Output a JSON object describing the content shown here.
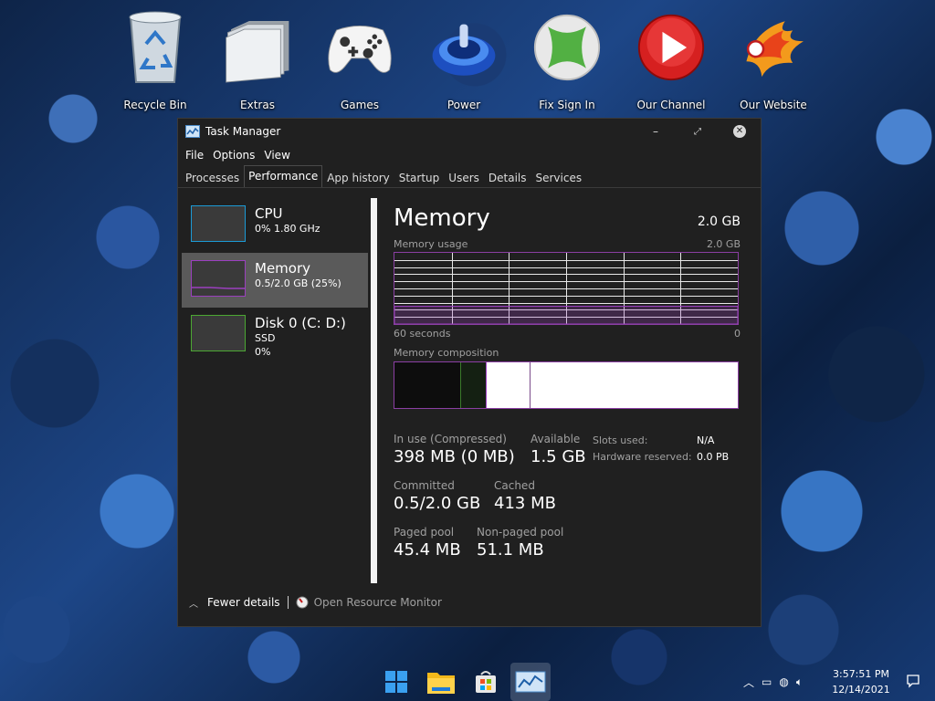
{
  "desktop": {
    "icons": [
      {
        "label": "Recycle Bin",
        "icon": "recycle-bin-icon"
      },
      {
        "label": "Extras",
        "icon": "folder-icon"
      },
      {
        "label": "Games",
        "icon": "gamepad-icon"
      },
      {
        "label": "Power",
        "icon": "power-icon"
      },
      {
        "label": "Fix Sign In",
        "icon": "xbox-icon"
      },
      {
        "label": "Our Channel",
        "icon": "play-icon"
      },
      {
        "label": "Our Website",
        "icon": "phoenix-logo-icon"
      }
    ]
  },
  "window": {
    "title": "Task Manager",
    "menu": [
      "File",
      "Options",
      "View"
    ],
    "tabs": [
      "Processes",
      "Performance",
      "App history",
      "Startup",
      "Users",
      "Details",
      "Services"
    ],
    "active_tab": "Performance"
  },
  "sidebar": {
    "items": [
      {
        "name": "CPU",
        "detail": "0%  1.80 GHz",
        "detail2": "",
        "color": "#1c9bd6"
      },
      {
        "name": "Memory",
        "detail": "0.5/2.0 GB (25%)",
        "detail2": "",
        "color": "#9b3fbf"
      },
      {
        "name": "Disk 0 (C: D:)",
        "detail": "SSD",
        "detail2": "0%",
        "color": "#4ca833"
      }
    ]
  },
  "memory": {
    "title": "Memory",
    "total": "2.0 GB",
    "usage_label": "Memory usage",
    "usage_max": "2.0 GB",
    "graph_left": "60 seconds",
    "graph_right": "0",
    "usage_fraction": 0.25,
    "composition_label": "Memory composition",
    "stats": {
      "in_use_label": "In use (Compressed)",
      "in_use_value": "398 MB (0 MB)",
      "available_label": "Available",
      "available_value": "1.5 GB",
      "committed_label": "Committed",
      "committed_value": "0.5/2.0 GB",
      "cached_label": "Cached",
      "cached_value": "413 MB",
      "paged_label": "Paged pool",
      "paged_value": "45.4 MB",
      "nonpaged_label": "Non-paged pool",
      "nonpaged_value": "51.1 MB",
      "slots_label": "Slots used:",
      "slots_value": "N/A",
      "hw_label": "Hardware reserved:",
      "hw_value": "0.0 PB"
    }
  },
  "footer": {
    "fewer": "Fewer details",
    "resource_monitor": "Open Resource Monitor"
  },
  "taskbar": {
    "apps": [
      "windows-start-icon",
      "file-explorer-icon",
      "store-icon",
      "task-manager-icon"
    ],
    "clock_time": "3:57:51 PM",
    "clock_date": "12/14/2021"
  },
  "colors": {
    "accent_memory": "#9b3fbf",
    "accent_cpu": "#1c9bd6",
    "accent_disk": "#4ca833"
  }
}
